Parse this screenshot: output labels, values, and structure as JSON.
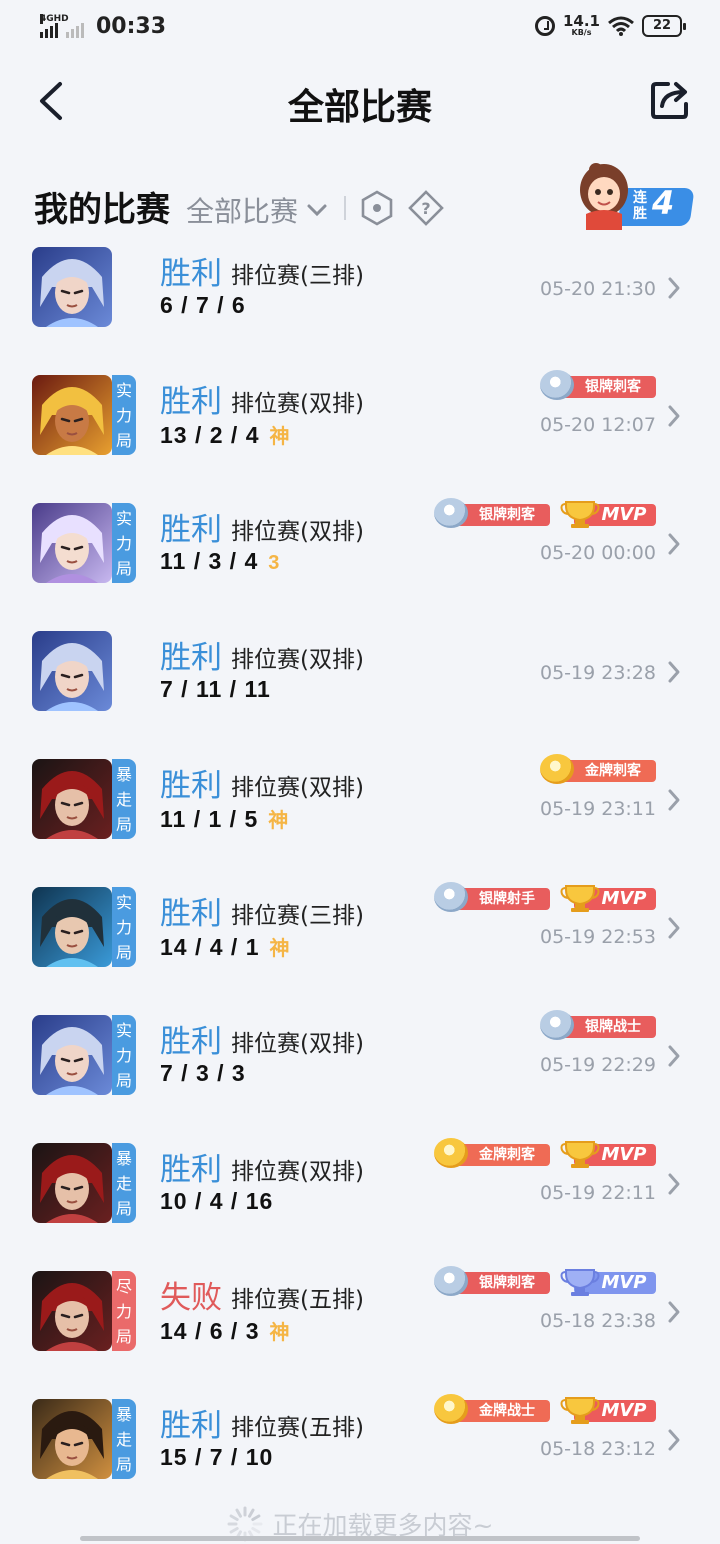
{
  "status_bar": {
    "network_label": "4GHD",
    "time": "00:33",
    "net_speed": "14.1",
    "net_speed_unit": "KB/s",
    "battery": "22"
  },
  "header": {
    "title": "全部比赛",
    "back_icon": "chevron-left-icon",
    "share_icon": "share-icon"
  },
  "section": {
    "title": "我的比赛",
    "filter_label": "全部比赛",
    "streak_text": "连胜",
    "streak_count": "4"
  },
  "colors": {
    "win": "#3a8fd8",
    "lose": "#e05a5a",
    "tag_blue": "#4a9be0",
    "tag_red": "#ea6a6a",
    "god": "#f5b545",
    "background": "#f3f5f9"
  },
  "matches": [
    {
      "result": "胜利",
      "is_win": true,
      "type": "排位赛(三排)",
      "kda": "6 / 7 / 6",
      "extra": "",
      "time": "05-20 21:30",
      "tag": "",
      "badges": [],
      "hero": 0
    },
    {
      "result": "胜利",
      "is_win": true,
      "type": "排位赛(双排)",
      "kda": "13 / 2 / 4",
      "extra": "神",
      "time": "05-20 12:07",
      "tag": "实力局",
      "badges": [
        {
          "kind": "silver",
          "label": "银牌刺客"
        }
      ],
      "hero": 1
    },
    {
      "result": "胜利",
      "is_win": true,
      "type": "排位赛(双排)",
      "kda": "11 / 3 / 4",
      "extra": "3",
      "time": "05-20 00:00",
      "tag": "实力局",
      "badges": [
        {
          "kind": "silver",
          "label": "银牌刺客"
        },
        {
          "kind": "mvp",
          "label": "MVP"
        }
      ],
      "hero": 2
    },
    {
      "result": "胜利",
      "is_win": true,
      "type": "排位赛(双排)",
      "kda": "7 / 11 / 11",
      "extra": "",
      "time": "05-19 23:28",
      "tag": "",
      "badges": [],
      "hero": 0
    },
    {
      "result": "胜利",
      "is_win": true,
      "type": "排位赛(双排)",
      "kda": "11 / 1 / 5",
      "extra": "神",
      "time": "05-19 23:11",
      "tag": "暴走局",
      "badges": [
        {
          "kind": "gold",
          "label": "金牌刺客"
        }
      ],
      "hero": 3
    },
    {
      "result": "胜利",
      "is_win": true,
      "type": "排位赛(三排)",
      "kda": "14 / 4 / 1",
      "extra": "神",
      "time": "05-19 22:53",
      "tag": "实力局",
      "badges": [
        {
          "kind": "silver",
          "label": "银牌射手"
        },
        {
          "kind": "mvp",
          "label": "MVP"
        }
      ],
      "hero": 4
    },
    {
      "result": "胜利",
      "is_win": true,
      "type": "排位赛(双排)",
      "kda": "7 / 3 / 3",
      "extra": "",
      "time": "05-19 22:29",
      "tag": "实力局",
      "badges": [
        {
          "kind": "silver",
          "label": "银牌战士"
        }
      ],
      "hero": 0
    },
    {
      "result": "胜利",
      "is_win": true,
      "type": "排位赛(双排)",
      "kda": "10 / 4 / 16",
      "extra": "",
      "time": "05-19 22:11",
      "tag": "暴走局",
      "badges": [
        {
          "kind": "gold",
          "label": "金牌刺客"
        },
        {
          "kind": "mvp",
          "label": "MVP"
        }
      ],
      "hero": 3
    },
    {
      "result": "失败",
      "is_win": false,
      "type": "排位赛(五排)",
      "kda": "14 / 6 / 3",
      "extra": "神",
      "time": "05-18 23:38",
      "tag": "尽力局",
      "badges": [
        {
          "kind": "silver",
          "label": "银牌刺客"
        },
        {
          "kind": "mvp-blue",
          "label": "MVP"
        }
      ],
      "hero": 3
    },
    {
      "result": "胜利",
      "is_win": true,
      "type": "排位赛(五排)",
      "kda": "15 / 7 / 10",
      "extra": "",
      "time": "05-18 23:12",
      "tag": "暴走局",
      "badges": [
        {
          "kind": "gold",
          "label": "金牌战士"
        },
        {
          "kind": "mvp",
          "label": "MVP"
        }
      ],
      "hero": 5
    }
  ],
  "footer": {
    "loading_text": "正在加载更多内容~"
  }
}
